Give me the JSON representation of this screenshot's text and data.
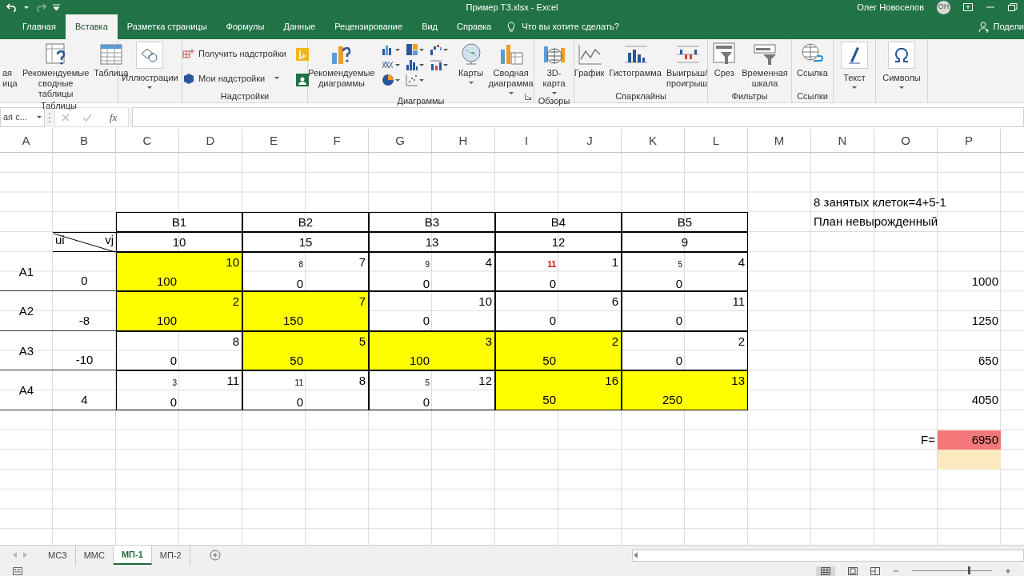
{
  "window": {
    "title": "Пример ТЗ.xlsx  -  Excel",
    "user": "Олег Новоселов",
    "avatar": "ОН"
  },
  "ribbon_tabs": [
    {
      "label": "Главная",
      "selected": false
    },
    {
      "label": "Вставка",
      "selected": true
    },
    {
      "label": "Разметка страницы",
      "selected": false
    },
    {
      "label": "Формулы",
      "selected": false
    },
    {
      "label": "Данные",
      "selected": false
    },
    {
      "label": "Рецензирование",
      "selected": false
    },
    {
      "label": "Вид",
      "selected": false
    },
    {
      "label": "Справка",
      "selected": false
    }
  ],
  "tell_me": "Что вы хотите сделать?",
  "share": "Подели",
  "ribbon_groups": [
    {
      "label": "Таблицы",
      "items": [
        {
          "kind": "large",
          "label": "ая\nица"
        },
        {
          "kind": "large",
          "label": "Рекомендуемые\nсводные таблицы"
        },
        {
          "kind": "large",
          "label": "Таблица"
        }
      ]
    },
    {
      "items": [
        {
          "kind": "boxed",
          "label": "Иллюстрации",
          "caret": true
        }
      ]
    },
    {
      "label": "Надстройки",
      "items": [
        {
          "kind": "small",
          "label": "Получить надстройки"
        },
        {
          "kind": "small",
          "label": "Мои надстройки",
          "caret": true
        },
        {
          "kind": "icon"
        },
        {
          "kind": "icon"
        }
      ]
    },
    {
      "label": "Диаграммы",
      "launcher": true,
      "items": [
        {
          "kind": "large",
          "label": "Рекомендуемые\nдиаграммы"
        },
        {
          "kind": "icon",
          "caret": true
        },
        {
          "kind": "icon",
          "caret": true
        },
        {
          "kind": "icon",
          "caret": true
        },
        {
          "kind": "icon",
          "caret": true
        },
        {
          "kind": "icon",
          "caret": true
        },
        {
          "kind": "icon",
          "caret": true
        },
        {
          "kind": "icon",
          "caret": true
        },
        {
          "kind": "icon",
          "caret": true
        },
        {
          "kind": "large",
          "label": "Карты",
          "caret": true
        },
        {
          "kind": "large",
          "label": "Сводная\nдиаграмма",
          "caret": true
        }
      ]
    },
    {
      "label": "Обзоры",
      "items": [
        {
          "kind": "large",
          "label": "3D-\nкарта",
          "caret": true
        }
      ]
    },
    {
      "label": "Спарклайны",
      "items": [
        {
          "kind": "large",
          "label": "График"
        },
        {
          "kind": "large",
          "label": "Гистограмма"
        },
        {
          "kind": "large",
          "label": "Выигрыш/\nпроигрыш"
        }
      ]
    },
    {
      "label": "Фильтры",
      "items": [
        {
          "kind": "large",
          "label": "Срез"
        },
        {
          "kind": "large",
          "label": "Временная\nшкала"
        }
      ]
    },
    {
      "label": "Ссылки",
      "items": [
        {
          "kind": "large",
          "label": "Ссылка"
        }
      ]
    },
    {
      "items": [
        {
          "kind": "boxed",
          "label": "Текст",
          "caret": true
        }
      ]
    },
    {
      "items": [
        {
          "kind": "boxed",
          "label": "Символы",
          "caret": true
        }
      ]
    }
  ],
  "formula_bar": {
    "name_box": "ая с...",
    "function_label": "fx"
  },
  "columns": [
    "A",
    "B",
    "C",
    "D",
    "E",
    "F",
    "G",
    "H",
    "I",
    "J",
    "K",
    "L",
    "M",
    "N",
    "O",
    "P"
  ],
  "notes": [
    "8 занятых клеток=4+5-1",
    "План невырожденный"
  ],
  "transport": {
    "corner": {
      "row_label": "ui",
      "col_label": "vj"
    },
    "consumers": [
      {
        "name": "B1",
        "v": "10"
      },
      {
        "name": "B2",
        "v": "15"
      },
      {
        "name": "B3",
        "v": "13"
      },
      {
        "name": "B4",
        "v": "12"
      },
      {
        "name": "B5",
        "v": "9"
      }
    ],
    "suppliers": [
      {
        "name": "A1",
        "u": "0",
        "supply": "1000",
        "cells": [
          {
            "basic": true,
            "cost": "10",
            "allocation": "100"
          },
          {
            "basic": false,
            "estimate": "8",
            "highlight": false,
            "cost": "7",
            "allocation": "0"
          },
          {
            "basic": false,
            "estimate": "9",
            "highlight": false,
            "cost": "4",
            "allocation": "0"
          },
          {
            "basic": false,
            "estimate": "11",
            "highlight": true,
            "cost": "1",
            "allocation": "0"
          },
          {
            "basic": false,
            "estimate": "5",
            "highlight": false,
            "cost": "4",
            "allocation": "0"
          }
        ]
      },
      {
        "name": "A2",
        "u": "-8",
        "supply": "1250",
        "cells": [
          {
            "basic": true,
            "cost": "2",
            "allocation": "100"
          },
          {
            "basic": true,
            "cost": "7",
            "allocation": "150"
          },
          {
            "basic": false,
            "cost": "10",
            "allocation": "0"
          },
          {
            "basic": false,
            "cost": "6",
            "allocation": "0"
          },
          {
            "basic": false,
            "cost": "11",
            "allocation": "0"
          }
        ]
      },
      {
        "name": "A3",
        "u": "-10",
        "supply": "650",
        "cells": [
          {
            "basic": false,
            "cost": "8",
            "allocation": "0"
          },
          {
            "basic": true,
            "cost": "5",
            "allocation": "50"
          },
          {
            "basic": true,
            "cost": "3",
            "allocation": "100"
          },
          {
            "basic": true,
            "cost": "2",
            "allocation": "50"
          },
          {
            "basic": false,
            "cost": "2",
            "allocation": "0"
          }
        ]
      },
      {
        "name": "A4",
        "u": "4",
        "supply": "4050",
        "cells": [
          {
            "basic": false,
            "estimate": "3",
            "highlight": false,
            "cost": "11",
            "allocation": "0"
          },
          {
            "basic": false,
            "estimate": "11",
            "highlight": false,
            "cost": "8",
            "allocation": "0"
          },
          {
            "basic": false,
            "estimate": "5",
            "highlight": false,
            "cost": "12",
            "allocation": "0"
          },
          {
            "basic": true,
            "cost": "16",
            "allocation": "50"
          },
          {
            "basic": true,
            "cost": "13",
            "allocation": "250"
          }
        ]
      }
    ]
  },
  "objective": {
    "label": "F=",
    "value": "6950"
  },
  "sheet_tabs": [
    {
      "label": "МСЗ",
      "selected": false
    },
    {
      "label": "ММС",
      "selected": false
    },
    {
      "label": "МП-1",
      "selected": true
    },
    {
      "label": "МП-2",
      "selected": false
    }
  ]
}
